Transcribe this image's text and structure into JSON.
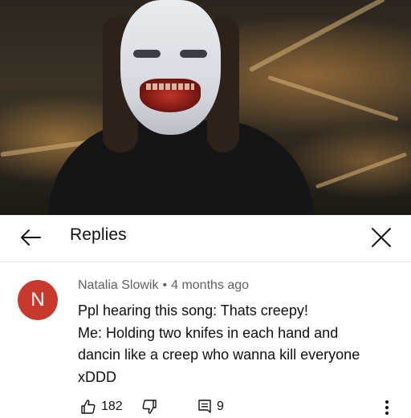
{
  "header": {
    "title": "Replies"
  },
  "comment": {
    "avatar_letter": "N",
    "avatar_color": "#c6392c",
    "author": "Natalia Slowik",
    "separator": "•",
    "time": "4 months ago",
    "lines": [
      "Ppl hearing this song: Thats creepy!",
      "Me: Holding two knifes in each hand and",
      "dancin like a creep who wanna kill everyone",
      "xDDD"
    ],
    "likes": "182",
    "replies": "9"
  },
  "icons": {
    "back": "arrow-left-icon",
    "close": "close-icon",
    "like": "thumbs-up-icon",
    "dislike": "thumbs-down-icon",
    "reply": "comment-icon",
    "more": "more-vertical-icon"
  }
}
